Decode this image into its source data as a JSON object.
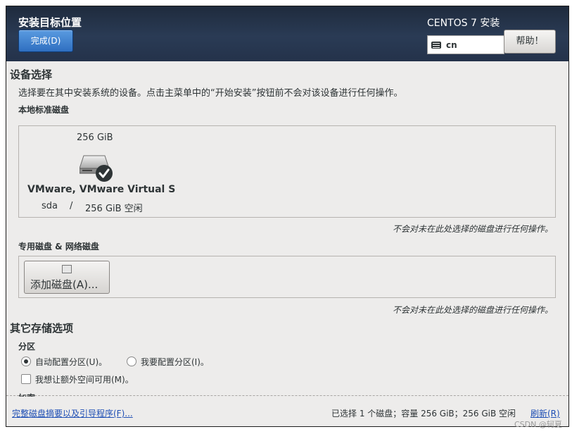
{
  "header": {
    "title": "安装目标位置",
    "done_label": "完成(D)",
    "product": "CENTOS 7 安装",
    "keyboard": "cn",
    "help_label": "帮助！"
  },
  "device_selection": {
    "heading": "设备选择",
    "description": "选择要在其中安装系统的设备。点击主菜单中的“开始安装”按钮前不会对该设备进行任何操作。",
    "local_heading": "本地标准磁盘",
    "disks": [
      {
        "size": "256 GiB",
        "name": "VMware, VMware Virtual S",
        "device": "sda",
        "separator": "/",
        "free": "256 GiB 空闲",
        "selected": true
      }
    ],
    "local_note": "不会对未在此处选择的磁盘进行任何操作。",
    "specialized_heading": "专用磁盘 & 网络磁盘",
    "add_disk_label": "添加磁盘(A)...",
    "specialized_note": "不会对未在此处选择的磁盘进行任何操作。"
  },
  "other_options": {
    "heading": "其它存储选项",
    "partition_heading": "分区",
    "auto_partition_label": "自动配置分区(U)。",
    "auto_partition_selected": true,
    "manual_partition_label": "我要配置分区(I)。",
    "manual_partition_selected": false,
    "extra_space_label": "我想让额外空间可用(M)。",
    "extra_space_checked": false,
    "encryption_heading": "加密"
  },
  "footer": {
    "summary_link": "完整磁盘摘要以及引导程序(F)...",
    "status": "已选择 1 个磁盘；容量 256 GiB；256 GiB 空闲",
    "refresh_label": "刷新(R)"
  },
  "watermark": "CSDN @轲夏",
  "colors": {
    "header_bg": "#24324a",
    "done_button": "#2f6fc0",
    "link": "#1f4fb5",
    "window_bg": "#edeceb"
  },
  "icons": {
    "disk": "hard-disk-icon",
    "selected": "checkmark-icon",
    "keyboard": "keyboard-icon"
  }
}
